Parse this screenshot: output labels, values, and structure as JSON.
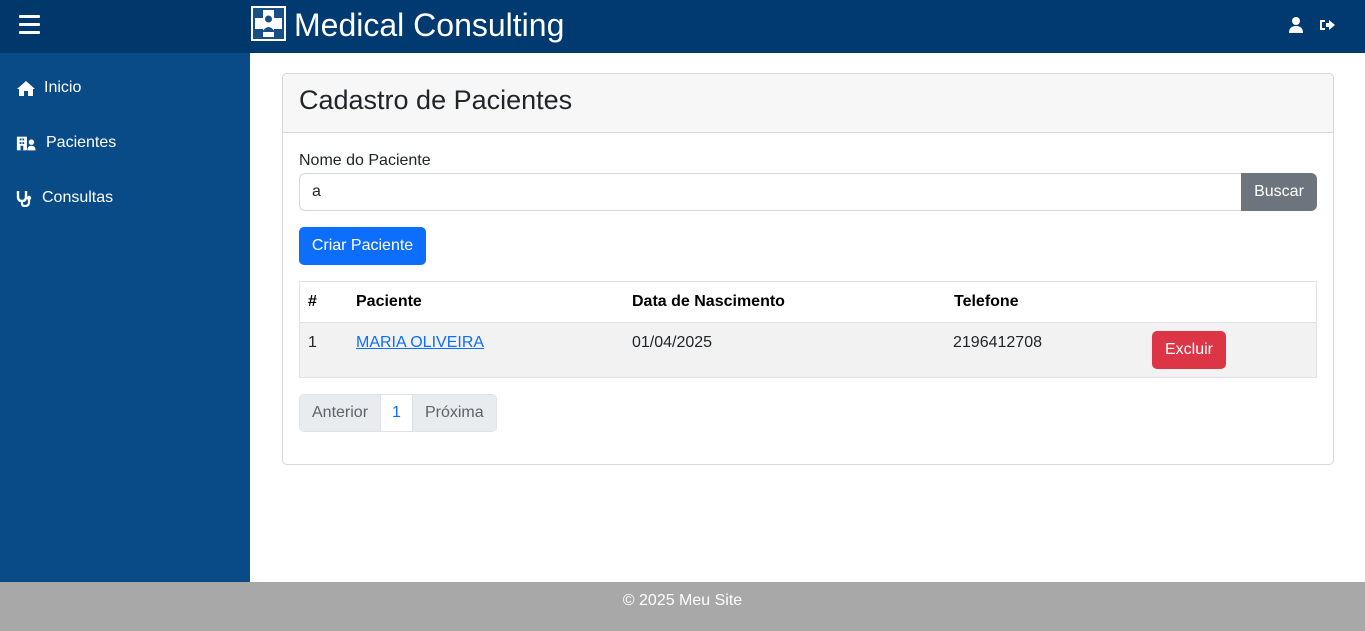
{
  "header": {
    "brand": "Medical Consulting",
    "menu_icon": "hamburger-menu-icon",
    "logo_icon": "medical-logo-icon",
    "user_icon": "user-icon",
    "logout_icon": "sign-out-icon",
    "background_color": "#003a70"
  },
  "sidebar": {
    "background_color": "#084b86",
    "items": [
      {
        "label": "Inicio",
        "icon": "home-icon"
      },
      {
        "label": "Pacientes",
        "icon": "hospital-user-icon"
      },
      {
        "label": "Consultas",
        "icon": "stethoscope-icon"
      }
    ]
  },
  "main": {
    "card_title": "Cadastro de Pacientes",
    "search": {
      "label": "Nome do Paciente",
      "value": "a",
      "button_label": "Buscar"
    },
    "create_button_label": "Criar Paciente",
    "table": {
      "headers": [
        "#",
        "Paciente",
        "Data de Nascimento",
        "Telefone"
      ],
      "rows": [
        {
          "id": "1",
          "name": "MARIA OLIVEIRA",
          "birth_date": "01/04/2025",
          "phone": "2196412708",
          "action_label": "Excluir"
        }
      ]
    },
    "pagination": {
      "previous_label": "Anterior",
      "current_page": "1",
      "next_label": "Próxima"
    }
  },
  "footer": {
    "text": "© 2025 Meu Site"
  },
  "colors": {
    "primary": "#0d6efd",
    "secondary": "#6c757d",
    "danger": "#dc3545",
    "footer": "#a8a8a8"
  }
}
